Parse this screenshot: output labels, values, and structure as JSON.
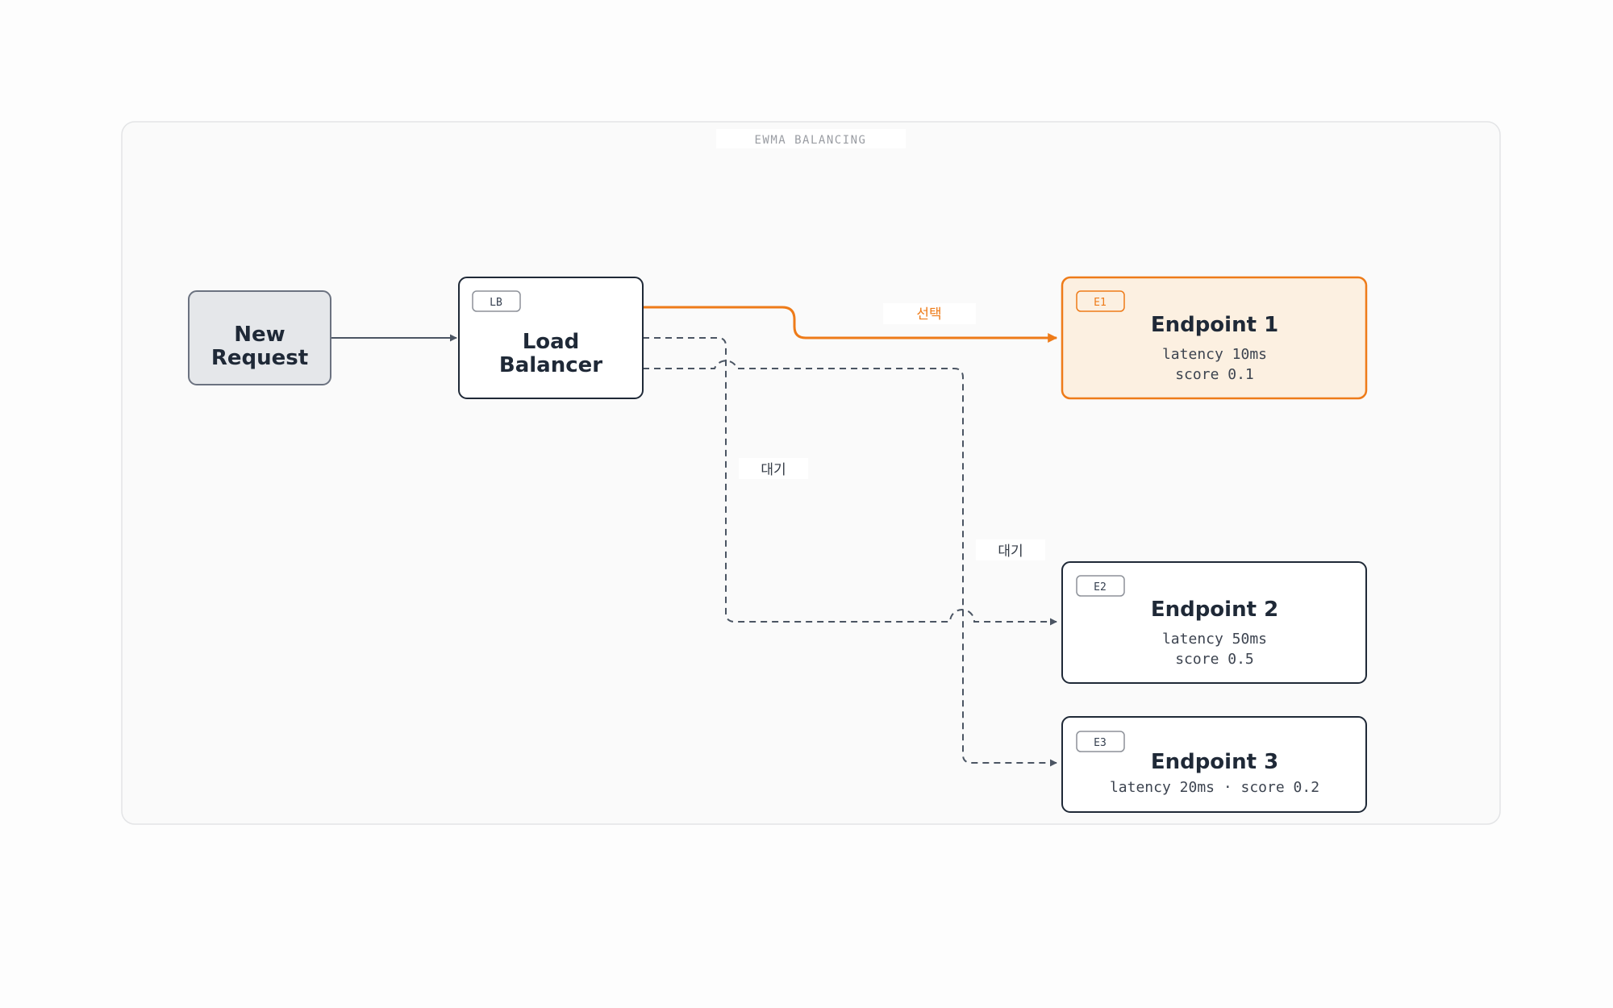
{
  "group": {
    "label": "EWMA BALANCING"
  },
  "nodes": {
    "request": {
      "title_line1": "New",
      "title_line2": "Request"
    },
    "lb": {
      "badge": "LB",
      "title_line1": "Load",
      "title_line2": "Balancer"
    },
    "e1": {
      "badge": "E1",
      "title": "Endpoint 1",
      "line1": "latency 10ms",
      "line2": "score 0.1",
      "highlighted": true
    },
    "e2": {
      "badge": "E2",
      "title": "Endpoint 2",
      "line1": "latency 50ms",
      "line2": "score 0.5"
    },
    "e3": {
      "badge": "E3",
      "title": "Endpoint 3",
      "line1": "latency 20ms · score 0.2"
    }
  },
  "edges": {
    "to_e1": {
      "label": "선택"
    },
    "to_e2": {
      "label": "대기"
    },
    "to_e3": {
      "label": "대기"
    }
  },
  "colors": {
    "accent": "#ee7b19",
    "node_border": "#1f2937",
    "start_fill": "#e5e7ea",
    "highlight_fill": "#fcf0e1"
  }
}
